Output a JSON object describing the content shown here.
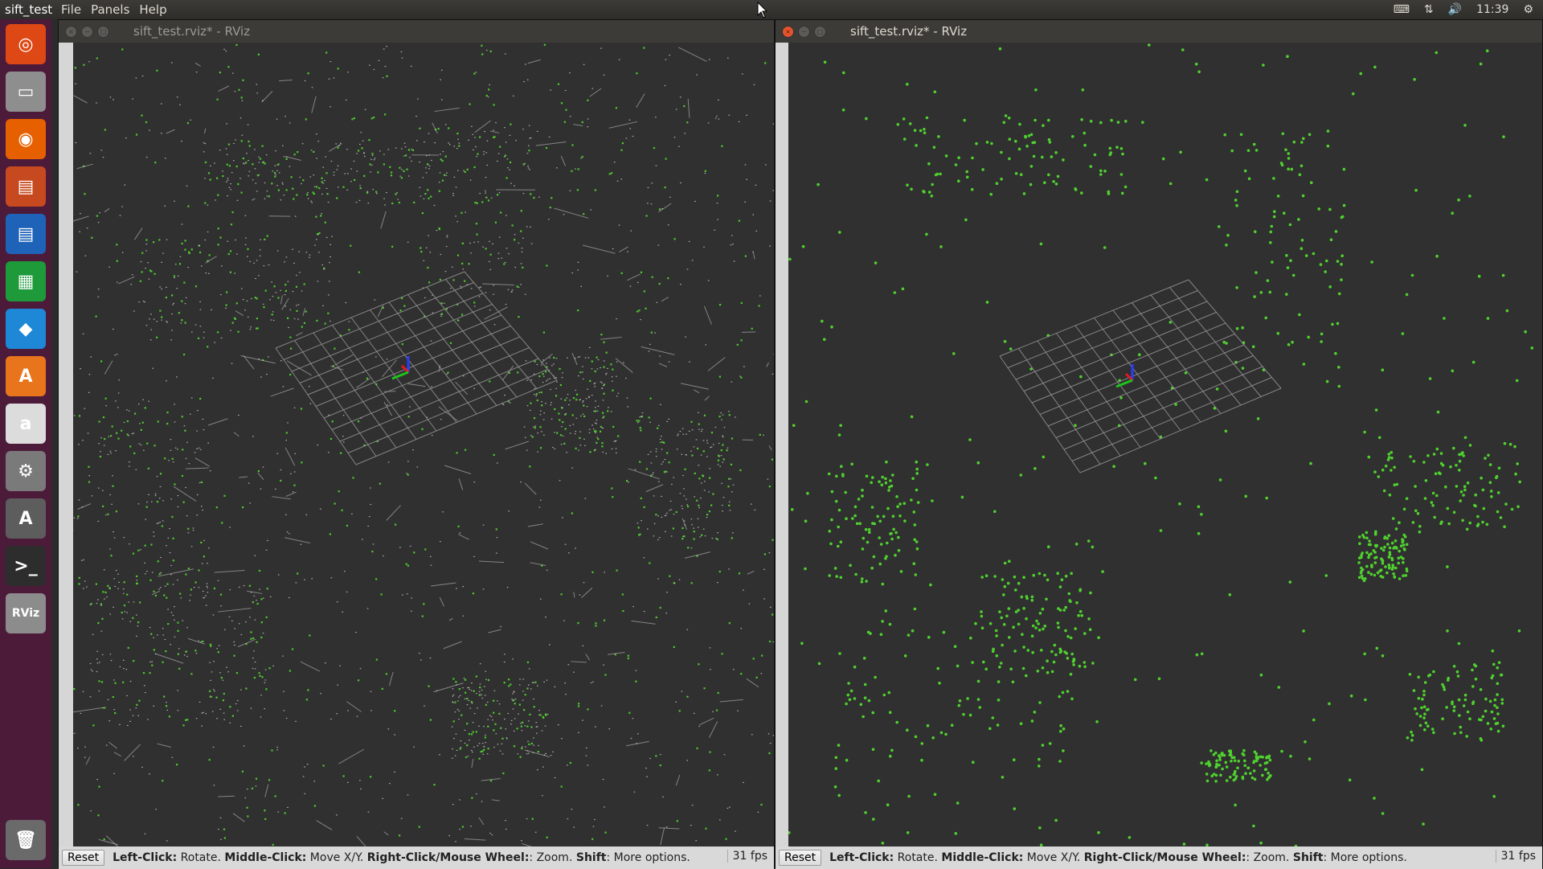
{
  "topbar": {
    "app_name": "sift_test",
    "menus": [
      "File",
      "Panels",
      "Help"
    ],
    "time": "11:39"
  },
  "launcher": {
    "items": [
      {
        "name": "ubuntu-dash-icon",
        "glyph": "◎",
        "color": "#dd4814"
      },
      {
        "name": "files-icon",
        "glyph": "▭",
        "color": "#8e8e8e"
      },
      {
        "name": "firefox-icon",
        "glyph": "◉",
        "color": "#e66000"
      },
      {
        "name": "impress-icon",
        "glyph": "▤",
        "color": "#c7491f"
      },
      {
        "name": "writer-icon",
        "glyph": "▤",
        "color": "#1e63b8"
      },
      {
        "name": "calc-icon",
        "glyph": "▦",
        "color": "#1f9a3b"
      },
      {
        "name": "vscode-icon",
        "glyph": "◆",
        "color": "#1e88d6"
      },
      {
        "name": "software-center-icon",
        "glyph": "A",
        "color": "#e8741c"
      },
      {
        "name": "amazon-icon",
        "glyph": "a",
        "color": "#dcdcdc"
      },
      {
        "name": "settings-icon",
        "glyph": "⚙",
        "color": "#7a7a7a"
      },
      {
        "name": "updater-icon",
        "glyph": "A",
        "color": "#5d5d5d"
      },
      {
        "name": "terminal-icon",
        "glyph": ">_",
        "color": "#2d2d2d"
      },
      {
        "name": "rviz-icon",
        "glyph": "RViz",
        "color": "#8c8c8c"
      }
    ],
    "trash": {
      "name": "trash-icon",
      "glyph": "🗑",
      "color": "#6a6a6a"
    }
  },
  "windows": [
    {
      "title": "sift_test.rviz* - RViz",
      "active": false,
      "reset_label": "Reset",
      "fps": "31 fps",
      "mode": "dense"
    },
    {
      "title": "sift_test.rviz* - RViz",
      "active": true,
      "reset_label": "Reset",
      "fps": "31 fps",
      "mode": "sparse"
    }
  ],
  "hint": {
    "k1": "Left-Click:",
    "v1": " Rotate. ",
    "k2": "Middle-Click:",
    "v2": " Move X/Y. ",
    "k3": "Right-Click/Mouse Wheel:",
    "v3": ": Zoom. ",
    "k4": "Shift",
    "v4": ": More options."
  },
  "colors": {
    "point_white": "#d8d8d8",
    "point_green": "#4fd12e",
    "grid": "#9a9a9a",
    "launcher_bg": "#4d1b3a"
  }
}
